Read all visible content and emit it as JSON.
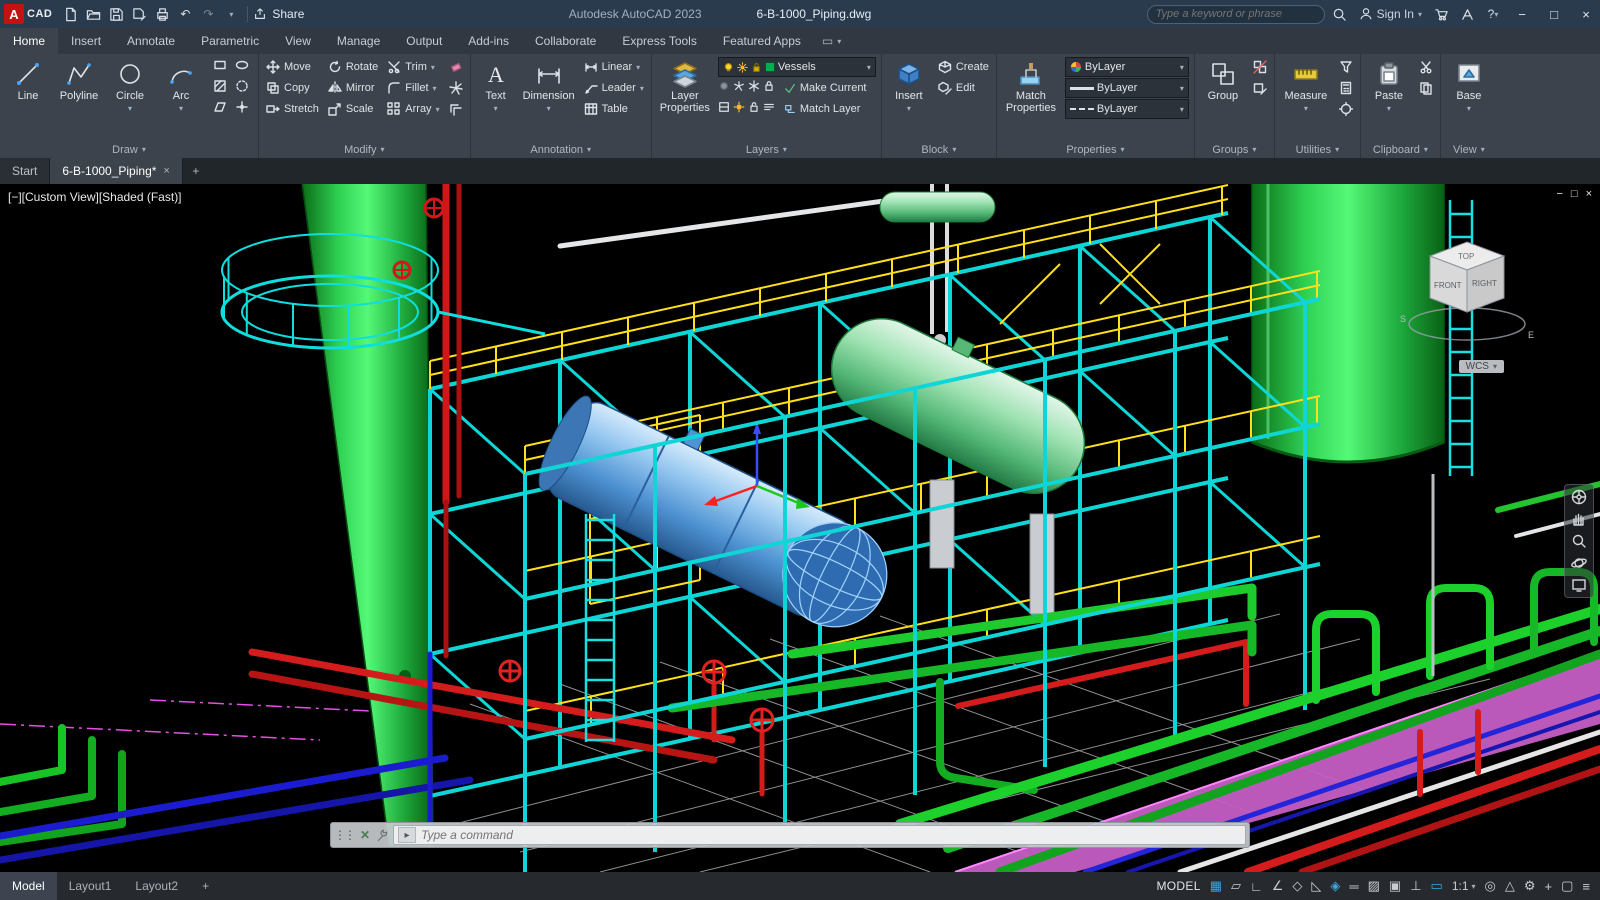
{
  "glyphs": {
    "caret": "▾",
    "undo": "↶",
    "redo": "↷",
    "min": "−",
    "max": "□",
    "close": "×",
    "help": "?",
    "plus": "+",
    "grip": "⋮⋮",
    "cmdx": "✕",
    "prompt": "▸",
    "grid": "▦",
    "snap": "▱",
    "ortho": "∟",
    "polar": "∠",
    "iso": "◇",
    "otrack": "◺",
    "osnap": "◈",
    "lweight": "═",
    "transp": "▨",
    "cycle": "▣",
    "ducs": "⊥",
    "dyn": "▭",
    "annovis": "◎",
    "autoscale": "△",
    "gear": "⚙",
    "monitor": "+",
    "clean": "▢",
    "burger": "≡",
    "ribbonbox": "▭"
  },
  "titlebar": {
    "logo": "A",
    "logo_suffix": "CAD",
    "share": "Share",
    "app_title": "Autodesk AutoCAD 2023",
    "doc_title": "6-B-1000_Piping.dwg",
    "search_placeholder": "Type a keyword or phrase",
    "sign_in": "Sign In"
  },
  "ribbon": {
    "tabs": [
      "Home",
      "Insert",
      "Annotate",
      "Parametric",
      "View",
      "Manage",
      "Output",
      "Add-ins",
      "Collaborate",
      "Express Tools",
      "Featured Apps"
    ],
    "panel_labels": {
      "draw": "Draw",
      "modify": "Modify",
      "annotation": "Annotation",
      "layers": "Layers",
      "block": "Block",
      "properties": "Properties",
      "groups": "Groups",
      "utilities": "Utilities",
      "clipboard": "Clipboard",
      "view": "View"
    },
    "draw": {
      "items": [
        "Line",
        "Polyline",
        "Circle",
        "Arc"
      ]
    },
    "modify": {
      "items": [
        "Move",
        "Copy",
        "Stretch",
        "Rotate",
        "Mirror",
        "Scale",
        "Trim",
        "Fillet",
        "Array"
      ]
    },
    "annotation": {
      "big": [
        "Text",
        "Dimension"
      ],
      "items": [
        "Linear",
        "Leader",
        "Table"
      ]
    },
    "layers": {
      "big": "Layer Properties",
      "current": "Vessels",
      "buttons": [
        "Make Current",
        "Match Layer"
      ]
    },
    "block": {
      "big": "Insert",
      "items": [
        "Create",
        "Edit"
      ]
    },
    "properties": {
      "big": "Match Properties",
      "values": [
        "ByLayer",
        "ByLayer",
        "ByLayer"
      ]
    },
    "groups": {
      "big": "Group"
    },
    "utilities": {
      "big": "Measure"
    },
    "clipboard": {
      "big": "Paste"
    },
    "view": {
      "big": "Base"
    }
  },
  "file_tabs": {
    "start": "Start",
    "active": "6-B-1000_Piping*"
  },
  "viewport": {
    "label": "[−][Custom View][Shaded (Fast)]",
    "viewcube": {
      "front": "FRONT",
      "right": "RIGHT",
      "top": "TOP",
      "south": "S",
      "east": "E"
    },
    "wcs": "WCS"
  },
  "command": {
    "placeholder": "Type a command"
  },
  "statusbar": {
    "tabs": [
      "Model",
      "Layout1",
      "Layout2"
    ],
    "model_space": "MODEL",
    "scale": "1:1"
  }
}
